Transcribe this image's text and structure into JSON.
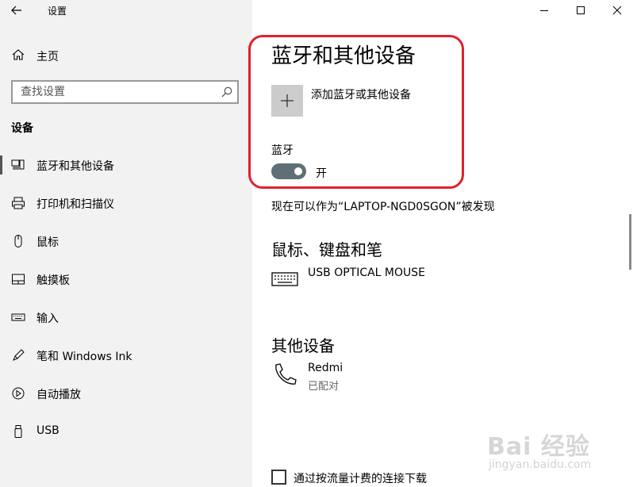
{
  "window": {
    "title": "设置",
    "controls": [
      "minimize",
      "maximize",
      "close"
    ]
  },
  "sidebar": {
    "home_label": "主页",
    "search_placeholder": "查找设置",
    "section_title": "设备",
    "items": [
      {
        "label": "蓝牙和其他设备",
        "icon": "bluetooth-devices-icon",
        "active": true
      },
      {
        "label": "打印机和扫描仪",
        "icon": "printer-icon",
        "active": false
      },
      {
        "label": "鼠标",
        "icon": "mouse-icon",
        "active": false
      },
      {
        "label": "触摸板",
        "icon": "touchpad-icon",
        "active": false
      },
      {
        "label": "输入",
        "icon": "keyboard-icon",
        "active": false
      },
      {
        "label": "笔和 Windows Ink",
        "icon": "pen-icon",
        "active": false
      },
      {
        "label": "自动播放",
        "icon": "autoplay-icon",
        "active": false
      },
      {
        "label": "USB",
        "icon": "usb-icon",
        "active": false
      }
    ]
  },
  "main": {
    "page_title": "蓝牙和其他设备",
    "add_device_label": "添加蓝牙或其他设备",
    "bluetooth_label": "蓝牙",
    "bluetooth_state": "开",
    "bluetooth_on": true,
    "discoverable_text": "现在可以作为“LAPTOP-NGD0SGON”被发现",
    "groups": [
      {
        "title": "鼠标、键盘和笔",
        "devices": [
          {
            "name": "USB OPTICAL MOUSE",
            "status": "",
            "icon": "keyboard-icon"
          }
        ]
      },
      {
        "title": "其他设备",
        "devices": [
          {
            "name": "Redmi",
            "status": "已配对",
            "icon": "phone-icon"
          }
        ]
      }
    ],
    "metered_label": "通过按流量计费的连接下载",
    "metered_checked": false
  },
  "watermark": {
    "text": "Bai 经验",
    "url": "jingyan.baidu.com"
  },
  "colors": {
    "highlight": "#e0212b",
    "toggle_on": "#5f6f78",
    "sidebar_bg": "#f2f2f2"
  }
}
